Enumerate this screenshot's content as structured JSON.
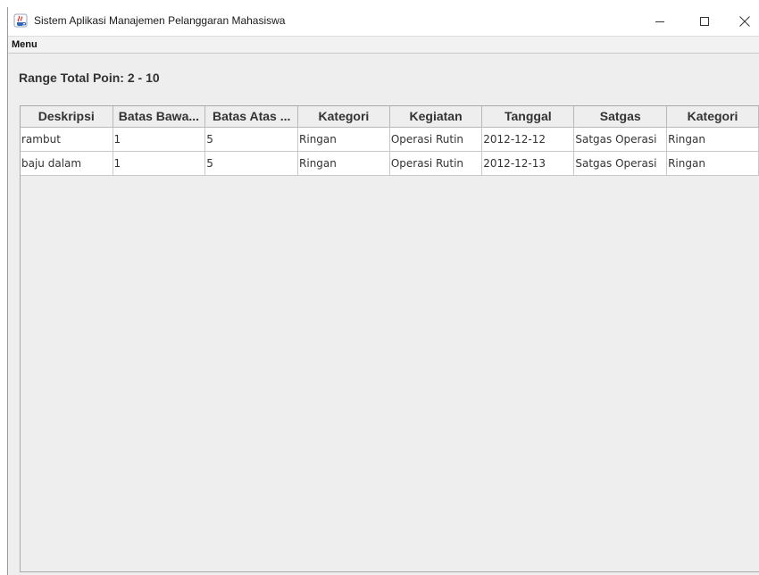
{
  "window": {
    "title": "Sistem Aplikasi Manajemen Pelanggaran Mahasiswa",
    "icon": "java-coffee-icon",
    "controls": [
      "minimize-icon",
      "maximize-icon",
      "close-icon"
    ]
  },
  "menubar": {
    "menu_label": "Menu"
  },
  "range_label": "Range Total Poin: 2 - 10",
  "table": {
    "columns": [
      "Deskripsi",
      "Batas Bawa...",
      "Batas Atas ...",
      "Kategori",
      "Kegiatan",
      "Tanggal",
      "Satgas",
      "Kategori"
    ],
    "rows": [
      [
        "rambut",
        "1",
        "5",
        "Ringan",
        "Operasi Rutin",
        "2012-12-12",
        "Satgas Operasi",
        "Ringan"
      ],
      [
        "baju dalam",
        "1",
        "5",
        "Ringan",
        "Operasi Rutin",
        "2012-12-13",
        "Satgas Operasi",
        "Ringan"
      ]
    ]
  }
}
